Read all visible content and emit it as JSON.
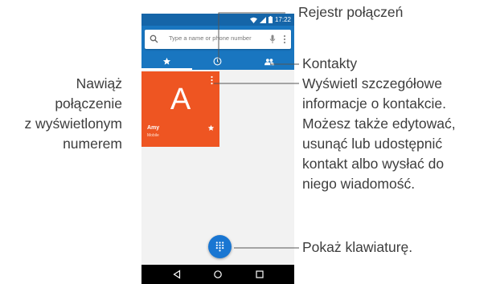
{
  "status_bar": {
    "time": "17:22"
  },
  "search": {
    "placeholder": "Type a name or phone number"
  },
  "tabs": [
    {
      "name": "tab-speed-dial",
      "icon": "star-icon",
      "active": true
    },
    {
      "name": "tab-call-log",
      "icon": "clock-icon",
      "active": false
    },
    {
      "name": "tab-contacts",
      "icon": "people-icon",
      "active": false
    }
  ],
  "contact_card": {
    "letter": "A",
    "name": "Amy",
    "subtitle": "Mobile",
    "color": "#ee5522"
  },
  "colors": {
    "primary": "#1976c0",
    "status_bar": "#1565a8",
    "fab": "#1976d2"
  },
  "annotations": {
    "call_log": "Rejestr połączeń",
    "contacts": "Kontakty",
    "call_number": [
      "Nawiąż",
      "połączenie",
      "z wyświetlonym",
      "numerem"
    ],
    "details": [
      "Wyświetl szczegółowe",
      "informacje o kontakcie.",
      "Możesz także edytować,",
      "usunąć lub udostępnić",
      "kontakt albo wysłać do",
      "niego wiadomość."
    ],
    "keypad": "Pokaż klawiaturę."
  }
}
